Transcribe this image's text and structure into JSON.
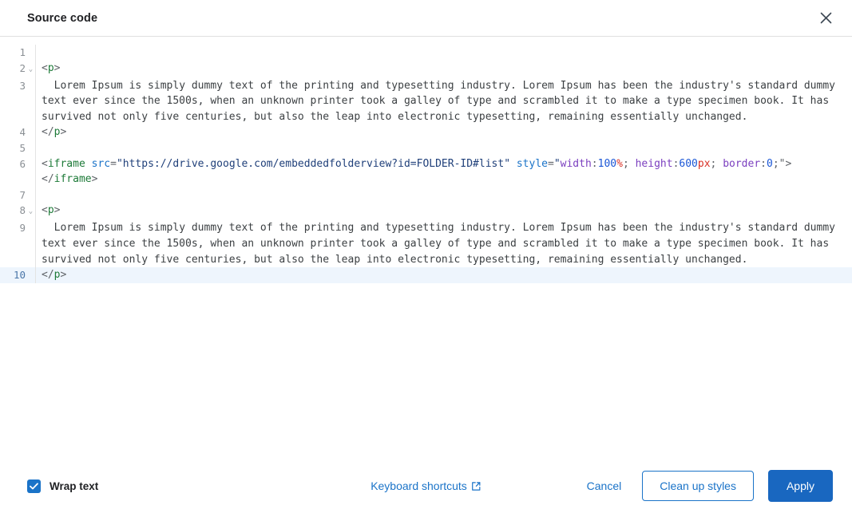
{
  "header": {
    "title": "Source code",
    "close_icon": "close-icon"
  },
  "editor": {
    "active_line": 10,
    "lines": [
      {
        "num": "1",
        "fold": false,
        "tokens": []
      },
      {
        "num": "2",
        "fold": true,
        "tokens": [
          {
            "t": "punct",
            "v": "<"
          },
          {
            "t": "tag",
            "v": "p"
          },
          {
            "t": "punct",
            "v": ">"
          }
        ]
      },
      {
        "num": "3",
        "fold": false,
        "tokens": [
          {
            "t": "text",
            "v": "  Lorem Ipsum is simply dummy text of the printing and typesetting industry. Lorem Ipsum has been the industry's standard dummy text ever since the 1500s, when an unknown printer took a galley of type and scrambled it to make a type specimen book. It has survived not only five centuries, but also the leap into electronic typesetting, remaining essentially unchanged."
          }
        ]
      },
      {
        "num": "4",
        "fold": false,
        "tokens": [
          {
            "t": "punct",
            "v": "</"
          },
          {
            "t": "tag",
            "v": "p"
          },
          {
            "t": "punct",
            "v": ">"
          }
        ]
      },
      {
        "num": "5",
        "fold": false,
        "tokens": []
      },
      {
        "num": "6",
        "fold": false,
        "tokens": [
          {
            "t": "punct",
            "v": "<"
          },
          {
            "t": "tag",
            "v": "iframe"
          },
          {
            "t": "text",
            "v": " "
          },
          {
            "t": "attr",
            "v": "src"
          },
          {
            "t": "punct",
            "v": "="
          },
          {
            "t": "string",
            "v": "\"https://drive.google.com/embeddedfolderview?id=FOLDER-ID#list\""
          },
          {
            "t": "text",
            "v": " "
          },
          {
            "t": "attr",
            "v": "style"
          },
          {
            "t": "punct",
            "v": "="
          },
          {
            "t": "string",
            "v": "\""
          },
          {
            "t": "prop",
            "v": "width"
          },
          {
            "t": "punct",
            "v": ":"
          },
          {
            "t": "num",
            "v": "100"
          },
          {
            "t": "unit",
            "v": "%"
          },
          {
            "t": "punct",
            "v": "; "
          },
          {
            "t": "prop",
            "v": "height"
          },
          {
            "t": "punct",
            "v": ":"
          },
          {
            "t": "num",
            "v": "600"
          },
          {
            "t": "unit",
            "v": "px"
          },
          {
            "t": "punct",
            "v": "; "
          },
          {
            "t": "prop",
            "v": "border"
          },
          {
            "t": "punct",
            "v": ":"
          },
          {
            "t": "num",
            "v": "0"
          },
          {
            "t": "punct",
            "v": ";\">"
          }
        ]
      },
      {
        "num": "",
        "fold": false,
        "tokens": [
          {
            "t": "punct",
            "v": "</"
          },
          {
            "t": "tag",
            "v": "iframe"
          },
          {
            "t": "punct",
            "v": ">"
          }
        ]
      },
      {
        "num": "7",
        "fold": false,
        "tokens": []
      },
      {
        "num": "8",
        "fold": true,
        "tokens": [
          {
            "t": "punct",
            "v": "<"
          },
          {
            "t": "tag",
            "v": "p"
          },
          {
            "t": "punct",
            "v": ">"
          }
        ]
      },
      {
        "num": "9",
        "fold": false,
        "tokens": [
          {
            "t": "text",
            "v": "  Lorem Ipsum is simply dummy text of the printing and typesetting industry. Lorem Ipsum has been the industry's standard dummy text ever since the 1500s, when an unknown printer took a galley of type and scrambled it to make a type specimen book. It has survived not only five centuries, but also the leap into electronic typesetting, remaining essentially unchanged."
          }
        ]
      },
      {
        "num": "10",
        "fold": false,
        "active": true,
        "tokens": [
          {
            "t": "punct",
            "v": "</"
          },
          {
            "t": "tag",
            "v": "p"
          },
          {
            "t": "punct",
            "v": ">"
          }
        ]
      }
    ]
  },
  "footer": {
    "wrap_text_label": "Wrap text",
    "wrap_text_checked": true,
    "keyboard_shortcuts_label": "Keyboard shortcuts",
    "keyboard_shortcuts_icon": "external-link-icon",
    "cancel_label": "Cancel",
    "clean_up_styles_label": "Clean up styles",
    "apply_label": "Apply"
  },
  "colors": {
    "accent": "#1a73c8",
    "primary_button": "#1967c0",
    "active_line": "#eef5fd",
    "tag": "#1d7a38",
    "attr": "#1a73c8",
    "string": "#20407a",
    "css_property": "#7b3fbf",
    "number": "#1a56d6",
    "unit": "#d93025"
  }
}
